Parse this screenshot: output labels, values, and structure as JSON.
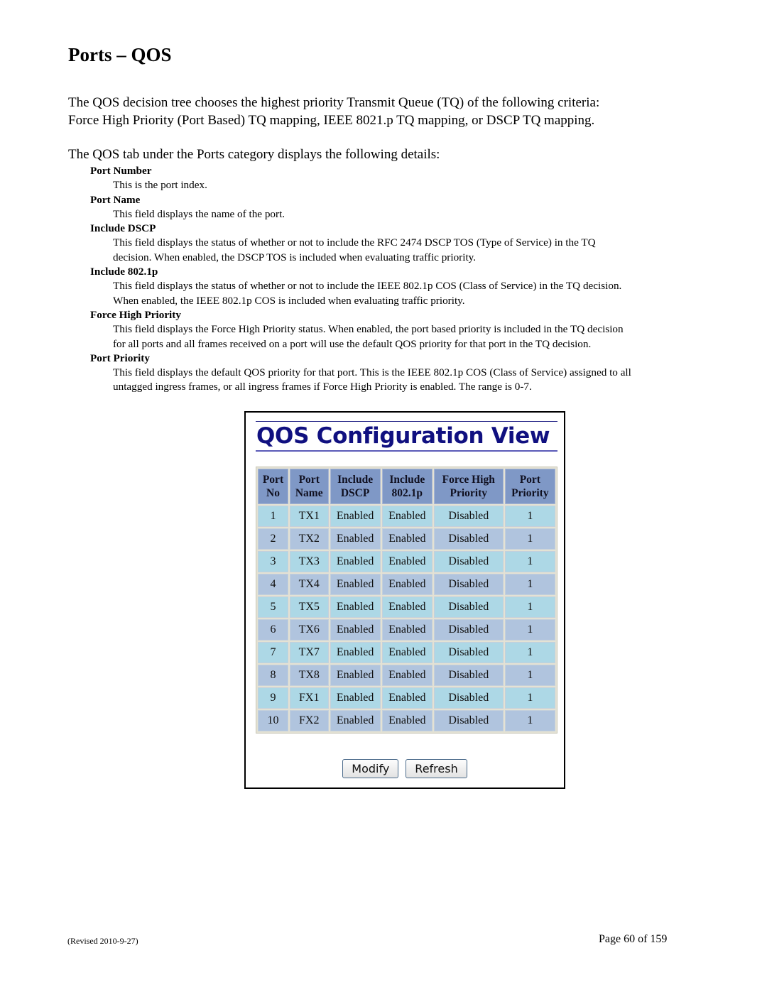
{
  "page": {
    "title": "Ports – QOS",
    "intro": "The QOS decision tree chooses the highest priority Transmit Queue (TQ) of the following criteria: Force High Priority (Port Based) TQ mapping, IEEE 8021.p TQ mapping, or DSCP TQ mapping.",
    "intro_line1": "The QOS decision tree chooses the highest priority Transmit Queue (TQ) of the following criteria:",
    "intro_line2": "Force High Priority (Port Based) TQ mapping, IEEE 8021.p TQ mapping, or DSCP TQ mapping.",
    "details_intro": "The QOS tab under the Ports category displays the following details:"
  },
  "definitions": [
    {
      "term": "Port Number",
      "lines": [
        "This is the port index."
      ]
    },
    {
      "term": "Port Name",
      "lines": [
        "This field displays the name of the port."
      ]
    },
    {
      "term": "Include DSCP",
      "lines": [
        "This field displays the status of whether or not to include the RFC 2474 DSCP TOS (Type of Service) in the TQ",
        "decision.  When enabled, the DSCP TOS is included when evaluating traffic priority."
      ]
    },
    {
      "term": "Include 802.1p",
      "lines": [
        "This field displays the status of whether or not to include the IEEE 802.1p COS (Class of Service) in the TQ decision.",
        "When enabled, the IEEE 802.1p COS is included when evaluating traffic priority."
      ]
    },
    {
      "term": "Force High Priority",
      "lines": [
        "This field displays the Force High Priority status.  When enabled, the port based priority is included in the TQ decision",
        "for all ports and all frames received on a port will use the default QOS priority for that port in the TQ decision."
      ]
    },
    {
      "term": "Port Priority",
      "lines": [
        "This field displays the default QOS priority for that port.  This is the IEEE 802.1p COS (Class of Service) assigned to all",
        "untagged ingress frames, or all ingress frames if Force High Priority is enabled.  The range is 0-7."
      ]
    }
  ],
  "screenshot": {
    "title": "QOS Configuration View",
    "columns": [
      {
        "line1": "Port",
        "line2": "No"
      },
      {
        "line1": "Port",
        "line2": "Name"
      },
      {
        "line1": "Include",
        "line2": "DSCP"
      },
      {
        "line1": "Include",
        "line2": "802.1p"
      },
      {
        "line1": "Force High",
        "line2": "Priority"
      },
      {
        "line1": "Port",
        "line2": "Priority"
      }
    ],
    "rows": [
      [
        "1",
        "TX1",
        "Enabled",
        "Enabled",
        "Disabled",
        "1"
      ],
      [
        "2",
        "TX2",
        "Enabled",
        "Enabled",
        "Disabled",
        "1"
      ],
      [
        "3",
        "TX3",
        "Enabled",
        "Enabled",
        "Disabled",
        "1"
      ],
      [
        "4",
        "TX4",
        "Enabled",
        "Enabled",
        "Disabled",
        "1"
      ],
      [
        "5",
        "TX5",
        "Enabled",
        "Enabled",
        "Disabled",
        "1"
      ],
      [
        "6",
        "TX6",
        "Enabled",
        "Enabled",
        "Disabled",
        "1"
      ],
      [
        "7",
        "TX7",
        "Enabled",
        "Enabled",
        "Disabled",
        "1"
      ],
      [
        "8",
        "TX8",
        "Enabled",
        "Enabled",
        "Disabled",
        "1"
      ],
      [
        "9",
        "FX1",
        "Enabled",
        "Enabled",
        "Disabled",
        "1"
      ],
      [
        "10",
        "FX2",
        "Enabled",
        "Enabled",
        "Disabled",
        "1"
      ]
    ],
    "buttons": {
      "modify": "Modify",
      "refresh": "Refresh"
    },
    "colors": {
      "title": "#101080",
      "header_bg": "#7f98c6",
      "row_odd": "#add8e6",
      "row_even": "#b0c4de"
    }
  },
  "footer": {
    "revised": "(Revised 2010-9-27)",
    "page": "Page 60 of 159"
  }
}
